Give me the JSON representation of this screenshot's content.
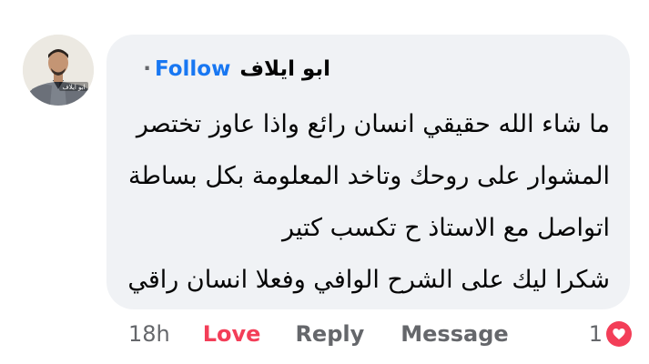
{
  "comment": {
    "author": "ابو ايلاف",
    "separator": "·",
    "follow_label": "Follow",
    "avatar_caption": "ابو ايلاف",
    "text_lines": [
      "ما شاء الله حقيقي انسان رائع واذا عاوز تختصر",
      "المشوار على روحك وتاخد المعلومة بكل بساطة",
      "اتواصل مع الاستاذ ح تكسب كتير",
      "شكرا ليك على الشرح الوافي وفعلا انسان راقي"
    ]
  },
  "actions": {
    "time": "18h",
    "love_label": "Love",
    "reply_label": "Reply",
    "message_label": "Message"
  },
  "reactions": {
    "count": "1",
    "icon": "heart-icon"
  },
  "colors": {
    "bubble_bg": "#f0f2f5",
    "follow_blue": "#1877f2",
    "love_red": "#f33e58",
    "meta_gray": "#65676b"
  }
}
